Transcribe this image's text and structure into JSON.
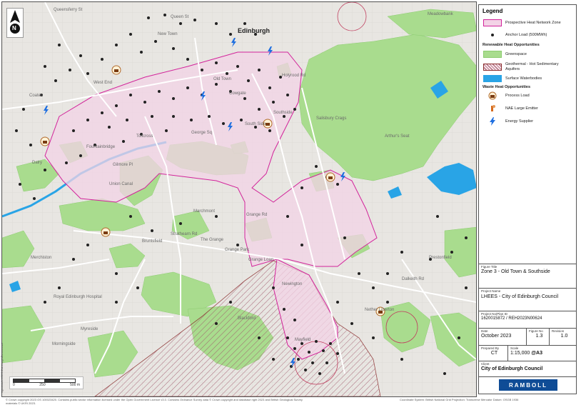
{
  "map": {
    "labels": {
      "edinburgh": "Edinburgh",
      "queensferry": "Queensferry St",
      "queen_st": "Queen St",
      "new_town": "New Town",
      "meadowbank": "Meadowbank",
      "west_end": "West End",
      "coates": "Coates",
      "old_town": "Old Town",
      "cowgate": "Cowgate",
      "holyrood": "Holyrood Rd",
      "southside": "Southside",
      "tollcross": "Tollcross",
      "fountainbridge": "Fountainbridge",
      "dalry": "Dalry",
      "gilmore_pl": "Gilmore Pl",
      "marchmont": "Marchmont",
      "bruntsfield": "Bruntsfield",
      "grange_rd": "Grange Rd",
      "grange_park": "Grange Park",
      "grange_loan": "Grange Loan",
      "the_grange": "The Grange",
      "strathearn": "Strathearn Rd",
      "merchiston": "Merchiston",
      "morningside": "Morningside",
      "newington": "Newington",
      "blackford": "Blackford",
      "mayfield": "Mayfield",
      "nether_liberton": "Nether Liberton",
      "prestonfield": "Prestonfield",
      "arthurs_seat": "Arthur's Seat",
      "salisbury": "Salisbury Crags",
      "dalkeith": "Dalkeith Rd",
      "lauriston": "George Sq",
      "royal_hospital": "Royal Edinburgh Hospital",
      "southsider": "South Side",
      "canal": "Union Canal",
      "myreside": "Myreside"
    },
    "north_label": "N",
    "scale": {
      "ticks": [
        "0",
        "250",
        "500 m"
      ]
    }
  },
  "legend": {
    "title": "Legend",
    "items": {
      "zone": "Prospective Heat Network Zone",
      "anchor": "Anchor Load (500MWh)",
      "renew_head": "Renewable Heat Opportunities",
      "green": "Greenspace",
      "geo": "Geothermal - Hot Sedimentary Aquifers",
      "water": "Surface Waterbodies",
      "waste_head": "Waste Heat Opportunities",
      "process": "Process Load",
      "nae": "NAE Large Emitter",
      "energy": "Energy Supplier"
    }
  },
  "title_block": {
    "figure_title_cap": "Figure Title",
    "figure_title": "Zone 3 - Old Town & Southside",
    "project_name_cap": "Project Name",
    "project_name": "LHEES - City of Edinburgh Council",
    "project_no_cap": "Project No/Plan ID",
    "project_no": "1620015872 / REH2023N00624",
    "date_cap": "Date",
    "date": "October 2023",
    "figure_no_cap": "Figure No",
    "figure_no": "1.3",
    "revision_cap": "Revision",
    "revision": "1.0",
    "prepared_cap": "Prepared By",
    "prepared": "CT",
    "scale_cap": "Scale",
    "scale": "1:15,000",
    "sheet": "@A3",
    "client_cap": "Client",
    "client": "City of Edinburgh Council",
    "logo": "RAMBOLL"
  },
  "footer": {
    "left": "© Crown copyright 2023 OS 100023420. Contains public sector information licensed under the Open Government Licence v3.0. Contains Ordnance Survey data © Crown copyright and database right 2023 and British Geological Survey materials © UKRI 2023.",
    "right": "Coordinate System: British National Grid Projection: Transverse Mercator Datum: OSGB 1936",
    "side": "\\\\gisdata\\LHEES\\Edinburgh\\Zones.mxd"
  },
  "colors": {
    "zone_fill": "#f3d3e6",
    "zone_stroke": "#d2239a",
    "green": "#a9dc8e",
    "water": "#29a4e6",
    "geo": "#8b2e2e",
    "base": "#e8e6e2"
  }
}
